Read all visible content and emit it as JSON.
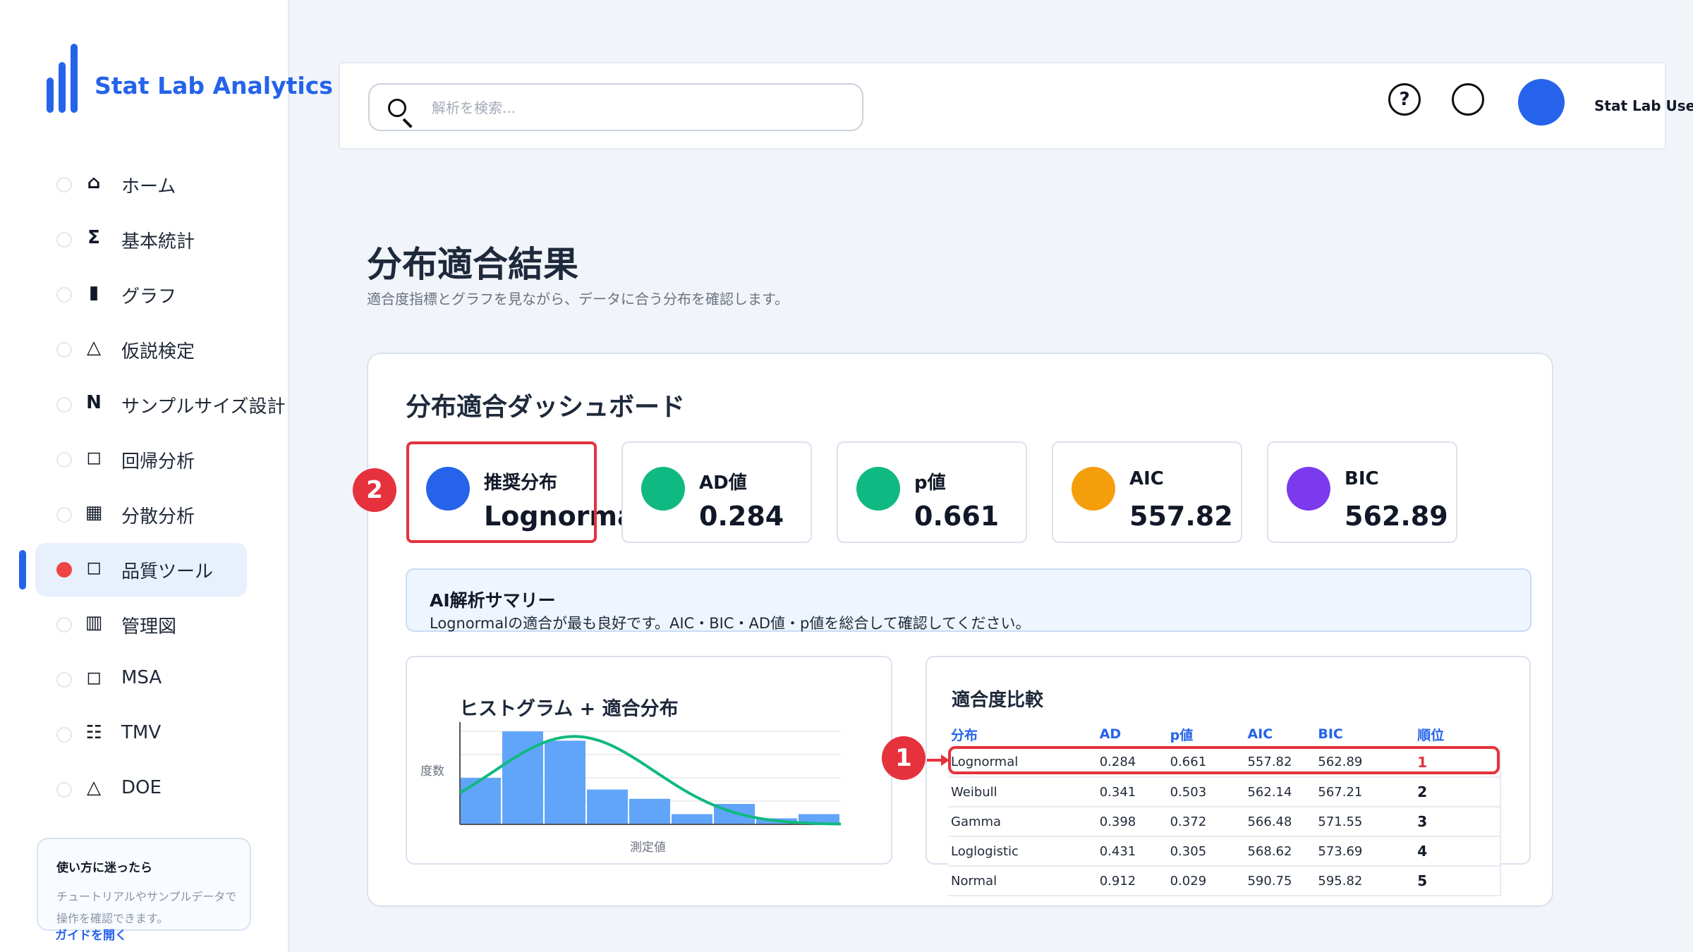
{
  "brand": {
    "name": "Stat Lab Analytics",
    "accent": "#2563eb"
  },
  "sidebar": {
    "items": [
      {
        "icon": "⌂",
        "label": "ホーム"
      },
      {
        "icon": "Σ",
        "label": "基本統計"
      },
      {
        "icon": "▮",
        "label": "グラフ"
      },
      {
        "icon": "△",
        "label": "仮説検定"
      },
      {
        "icon": "N",
        "label": "サンプルサイズ設計"
      },
      {
        "icon": "◻",
        "label": "回帰分析"
      },
      {
        "icon": "▦",
        "label": "分散分析"
      },
      {
        "icon": "◻",
        "label": "品質ツール",
        "active": true
      },
      {
        "icon": "▥",
        "label": "管理図"
      },
      {
        "icon": "◻",
        "label": "MSA"
      },
      {
        "icon": "☷",
        "label": "TMV"
      },
      {
        "icon": "△",
        "label": "DOE"
      }
    ],
    "help_title": "使い方に迷ったら",
    "help_body": "チュートリアルやサンプルデータで操作を確認できます。",
    "help_link": "ガイドを開く"
  },
  "header": {
    "search_placeholder": "解析を検索...",
    "help_icon": "?",
    "user_name": "Stat Lab User"
  },
  "page": {
    "title": "分布適合結果",
    "subtitle": "適合度指標とグラフを見ながら、データに合う分布を確認します。"
  },
  "dashboard": {
    "title": "分布適合ダッシュボード",
    "kpis": [
      {
        "label": "推奨分布",
        "value": "Lognormal",
        "color": "#2563eb"
      },
      {
        "label": "AD値",
        "value": "0.284",
        "color": "#10b981"
      },
      {
        "label": "p値",
        "value": "0.661",
        "color": "#10b981"
      },
      {
        "label": "AIC",
        "value": "557.82",
        "color": "#f59e0b"
      },
      {
        "label": "BIC",
        "value": "562.89",
        "color": "#7c3aed"
      }
    ],
    "ai_title": "AI解析サマリー",
    "ai_text": "Lognormalの適合が最も良好です。AIC・BIC・AD値・p値を総合して確認してください。",
    "badges": [
      "1",
      "2"
    ]
  },
  "chart_data": {
    "type": "bar",
    "title": "ヒストグラム + 適合分布",
    "xlabel": "測定値",
    "ylabel": "度数",
    "values": [
      10,
      20,
      18,
      7.5,
      5.5,
      2.2,
      4.4,
      1.3,
      2.2
    ],
    "ylim": [
      0,
      22
    ],
    "grid": true,
    "overlay": {
      "type": "line",
      "curve": "fitted-distribution",
      "color": "#10b981"
    },
    "bar_color": "#60a5fa"
  },
  "fit_table": {
    "title": "適合度比較",
    "columns": [
      "分布",
      "AD",
      "p値",
      "AIC",
      "BIC",
      "順位"
    ],
    "rows": [
      [
        "Lognormal",
        "0.284",
        "0.661",
        "557.82",
        "562.89",
        "1"
      ],
      [
        "Weibull",
        "0.341",
        "0.503",
        "562.14",
        "567.21",
        "2"
      ],
      [
        "Gamma",
        "0.398",
        "0.372",
        "566.48",
        "571.55",
        "3"
      ],
      [
        "Loglogistic",
        "0.431",
        "0.305",
        "568.62",
        "573.69",
        "4"
      ],
      [
        "Normal",
        "0.912",
        "0.029",
        "590.75",
        "595.82",
        "5"
      ]
    ]
  },
  "colors": {
    "highlight": "#e5323d",
    "panel_border": "#dbe2ec"
  }
}
